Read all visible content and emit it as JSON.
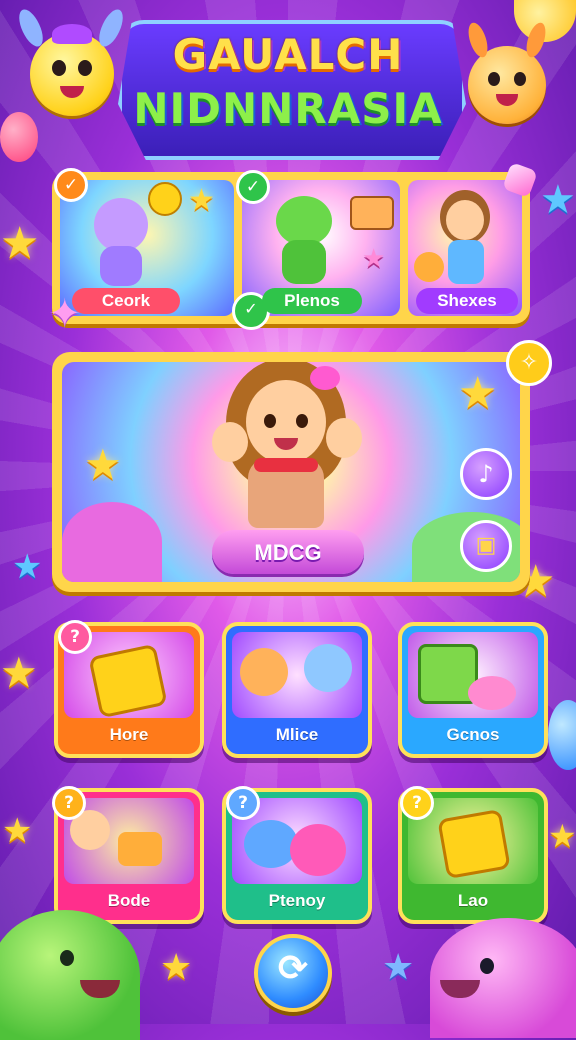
{
  "title": {
    "line1": "GAUALCH",
    "line2": "NIDNNRASIA"
  },
  "top_cards": [
    {
      "label": "Ceork",
      "badge_icon": "check-icon",
      "color": "#ff4f6a"
    },
    {
      "label": "Plenos",
      "badge_icon": "check-icon",
      "color": "#2fc44a"
    },
    {
      "label": "Shexes",
      "badge_icon": "gem-icon",
      "color": "#a13bff"
    }
  ],
  "featured": {
    "label": "MDCG",
    "side_buttons": [
      "music-icon",
      "book-icon"
    ]
  },
  "tiles": [
    {
      "label": "Hore",
      "badge": "?",
      "color": "#ff7a1a"
    },
    {
      "label": "Mlice",
      "badge": "",
      "color": "#2f6dff"
    },
    {
      "label": "Gcnos",
      "badge": "",
      "color": "#2aa8ff"
    },
    {
      "label": "Bode",
      "badge": "?",
      "color": "#ff2f8c"
    },
    {
      "label": "Ptenoy",
      "badge": "?",
      "color": "#1fbf8a"
    },
    {
      "label": "Lao",
      "badge": "?",
      "color": "#3fb830"
    }
  ],
  "center_button": {
    "icon": "refresh-icon",
    "glyph": "⟳"
  },
  "colors": {
    "frame": "#ffd54a",
    "accent_purple": "#9a2fd8"
  }
}
